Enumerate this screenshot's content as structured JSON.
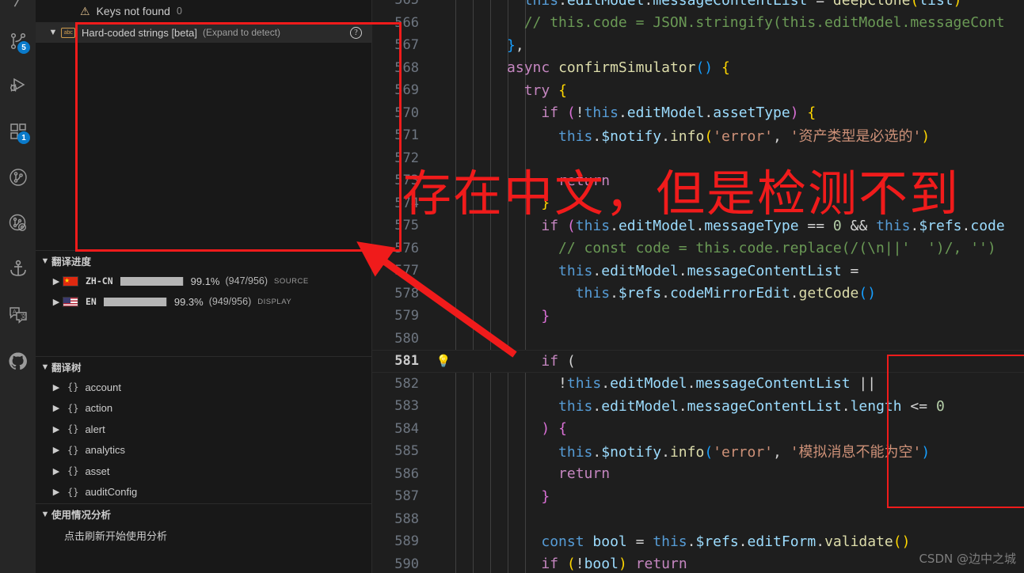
{
  "activity_bar": {
    "items": [
      {
        "name": "source-control-icon",
        "badge": "5"
      },
      {
        "name": "run-and-debug-icon",
        "badge": ""
      },
      {
        "name": "extensions-icon",
        "badge": "1"
      },
      {
        "name": "git-graph-icon",
        "badge": ""
      },
      {
        "name": "gitlens-icon",
        "badge": ""
      },
      {
        "name": "anchor-icon",
        "badge": ""
      },
      {
        "name": "i18n-ally-icon",
        "badge": ""
      },
      {
        "name": "github-icon",
        "badge": ""
      }
    ]
  },
  "sidebar": {
    "keys_not_found": {
      "label": "Keys not found",
      "count": "0"
    },
    "hardcoded": {
      "title": "Hard-coded strings [beta]",
      "hint": "(Expand to detect)",
      "help": "?",
      "icon": "abc"
    },
    "progress_section": {
      "title": "翻译进度",
      "rows": [
        {
          "lang": "ZH-CN",
          "flag": "cn",
          "percent": "99.1%",
          "fraction": "(947/956)",
          "tag": "SOURCE",
          "bar_pct": 99.1
        },
        {
          "lang": "EN",
          "flag": "us",
          "percent": "99.3%",
          "fraction": "(949/956)",
          "tag": "DISPLAY",
          "bar_pct": 99.3
        }
      ]
    },
    "tree_section": {
      "title": "翻译树",
      "items": [
        {
          "label": "account"
        },
        {
          "label": "action"
        },
        {
          "label": "alert"
        },
        {
          "label": "analytics"
        },
        {
          "label": "asset"
        },
        {
          "label": "auditConfig"
        }
      ]
    },
    "usage_section": {
      "title": "使用情况分析",
      "hint": "点击刷新开始使用分析"
    }
  },
  "editor": {
    "lines": [
      {
        "num": "565",
        "bulb": false,
        "tokens": [
          {
            "t": "        ",
            "c": "t-plain"
          },
          {
            "t": "this",
            "c": "t-kw2"
          },
          {
            "t": ".",
            "c": "t-plain"
          },
          {
            "t": "editModel",
            "c": "t-var"
          },
          {
            "t": ".",
            "c": "t-plain"
          },
          {
            "t": "messageContentList",
            "c": "t-var"
          },
          {
            "t": " = ",
            "c": "t-plain"
          },
          {
            "t": "deepClone",
            "c": "t-fn"
          },
          {
            "t": "(",
            "c": "t-pun"
          },
          {
            "t": "list",
            "c": "t-var"
          },
          {
            "t": ")",
            "c": "t-pun"
          }
        ]
      },
      {
        "num": "566",
        "bulb": false,
        "tokens": [
          {
            "t": "        // this.code = JSON.stringify(this.editModel.messageCont",
            "c": "t-com"
          }
        ]
      },
      {
        "num": "567",
        "bulb": false,
        "tokens": [
          {
            "t": "      ",
            "c": "t-plain"
          },
          {
            "t": "}",
            "c": "t-pun3"
          },
          {
            "t": ",",
            "c": "t-plain"
          }
        ]
      },
      {
        "num": "568",
        "bulb": false,
        "tokens": [
          {
            "t": "      ",
            "c": "t-plain"
          },
          {
            "t": "async ",
            "c": "t-kw"
          },
          {
            "t": "confirmSimulator",
            "c": "t-fn"
          },
          {
            "t": "(",
            "c": "t-pun3"
          },
          {
            "t": ")",
            "c": "t-pun3"
          },
          {
            "t": " ",
            "c": "t-plain"
          },
          {
            "t": "{",
            "c": "t-pun"
          }
        ]
      },
      {
        "num": "569",
        "bulb": false,
        "tokens": [
          {
            "t": "        ",
            "c": "t-plain"
          },
          {
            "t": "try",
            "c": "t-kw"
          },
          {
            "t": " ",
            "c": "t-plain"
          },
          {
            "t": "{",
            "c": "t-pun"
          }
        ]
      },
      {
        "num": "570",
        "bulb": false,
        "tokens": [
          {
            "t": "          ",
            "c": "t-plain"
          },
          {
            "t": "if",
            "c": "t-kw"
          },
          {
            "t": " ",
            "c": "t-plain"
          },
          {
            "t": "(",
            "c": "t-pun2"
          },
          {
            "t": "!",
            "c": "t-plain"
          },
          {
            "t": "this",
            "c": "t-kw2"
          },
          {
            "t": ".",
            "c": "t-plain"
          },
          {
            "t": "editModel",
            "c": "t-var"
          },
          {
            "t": ".",
            "c": "t-plain"
          },
          {
            "t": "assetType",
            "c": "t-var"
          },
          {
            "t": ")",
            "c": "t-pun2"
          },
          {
            "t": " ",
            "c": "t-plain"
          },
          {
            "t": "{",
            "c": "t-pun"
          }
        ]
      },
      {
        "num": "571",
        "bulb": false,
        "tokens": [
          {
            "t": "            ",
            "c": "t-plain"
          },
          {
            "t": "this",
            "c": "t-kw2"
          },
          {
            "t": ".",
            "c": "t-plain"
          },
          {
            "t": "$notify",
            "c": "t-var"
          },
          {
            "t": ".",
            "c": "t-plain"
          },
          {
            "t": "info",
            "c": "t-fn"
          },
          {
            "t": "(",
            "c": "t-pun"
          },
          {
            "t": "'error'",
            "c": "t-str"
          },
          {
            "t": ", ",
            "c": "t-plain"
          },
          {
            "t": "'资产类型是必选的'",
            "c": "t-str"
          },
          {
            "t": ")",
            "c": "t-pun"
          }
        ]
      },
      {
        "num": "572",
        "bulb": false,
        "tokens": []
      },
      {
        "num": "573",
        "bulb": false,
        "tokens": [
          {
            "t": "            ",
            "c": "t-plain"
          },
          {
            "t": "return",
            "c": "t-kw"
          }
        ]
      },
      {
        "num": "574",
        "bulb": false,
        "tokens": [
          {
            "t": "          ",
            "c": "t-plain"
          },
          {
            "t": "}",
            "c": "t-pun"
          }
        ]
      },
      {
        "num": "575",
        "bulb": false,
        "tokens": [
          {
            "t": "          ",
            "c": "t-plain"
          },
          {
            "t": "if",
            "c": "t-kw"
          },
          {
            "t": " ",
            "c": "t-plain"
          },
          {
            "t": "(",
            "c": "t-pun2"
          },
          {
            "t": "this",
            "c": "t-kw2"
          },
          {
            "t": ".",
            "c": "t-plain"
          },
          {
            "t": "editModel",
            "c": "t-var"
          },
          {
            "t": ".",
            "c": "t-plain"
          },
          {
            "t": "messageType",
            "c": "t-var"
          },
          {
            "t": " == ",
            "c": "t-plain"
          },
          {
            "t": "0",
            "c": "t-num"
          },
          {
            "t": " && ",
            "c": "t-plain"
          },
          {
            "t": "this",
            "c": "t-kw2"
          },
          {
            "t": ".",
            "c": "t-plain"
          },
          {
            "t": "$refs",
            "c": "t-var"
          },
          {
            "t": ".",
            "c": "t-plain"
          },
          {
            "t": "code",
            "c": "t-var"
          }
        ]
      },
      {
        "num": "576",
        "bulb": false,
        "tokens": [
          {
            "t": "            // const code = this.code.replace(/(\\n||'  ')/, '')",
            "c": "t-com"
          }
        ]
      },
      {
        "num": "577",
        "bulb": false,
        "tokens": [
          {
            "t": "            ",
            "c": "t-plain"
          },
          {
            "t": "this",
            "c": "t-kw2"
          },
          {
            "t": ".",
            "c": "t-plain"
          },
          {
            "t": "editModel",
            "c": "t-var"
          },
          {
            "t": ".",
            "c": "t-plain"
          },
          {
            "t": "messageContentList",
            "c": "t-var"
          },
          {
            "t": " =",
            "c": "t-plain"
          }
        ]
      },
      {
        "num": "578",
        "bulb": false,
        "tokens": [
          {
            "t": "              ",
            "c": "t-plain"
          },
          {
            "t": "this",
            "c": "t-kw2"
          },
          {
            "t": ".",
            "c": "t-plain"
          },
          {
            "t": "$refs",
            "c": "t-var"
          },
          {
            "t": ".",
            "c": "t-plain"
          },
          {
            "t": "codeMirrorEdit",
            "c": "t-var"
          },
          {
            "t": ".",
            "c": "t-plain"
          },
          {
            "t": "getCode",
            "c": "t-fn"
          },
          {
            "t": "(",
            "c": "t-pun3"
          },
          {
            "t": ")",
            "c": "t-pun3"
          }
        ]
      },
      {
        "num": "579",
        "bulb": false,
        "tokens": [
          {
            "t": "          ",
            "c": "t-plain"
          },
          {
            "t": "}",
            "c": "t-pun2"
          }
        ]
      },
      {
        "num": "580",
        "bulb": false,
        "tokens": []
      },
      {
        "num": "581",
        "bulb": true,
        "current": true,
        "tokens": [
          {
            "t": "          ",
            "c": "t-plain"
          },
          {
            "t": "if",
            "c": "t-kw"
          },
          {
            "t": " ",
            "c": "t-plain"
          },
          {
            "t": "(",
            "c": "t-plain"
          }
        ]
      },
      {
        "num": "582",
        "bulb": false,
        "tokens": [
          {
            "t": "            ",
            "c": "t-plain"
          },
          {
            "t": "!",
            "c": "t-plain"
          },
          {
            "t": "this",
            "c": "t-kw2"
          },
          {
            "t": ".",
            "c": "t-plain"
          },
          {
            "t": "editModel",
            "c": "t-var"
          },
          {
            "t": ".",
            "c": "t-plain"
          },
          {
            "t": "messageContentList",
            "c": "t-var"
          },
          {
            "t": " ||",
            "c": "t-plain"
          }
        ]
      },
      {
        "num": "583",
        "bulb": false,
        "tokens": [
          {
            "t": "            ",
            "c": "t-plain"
          },
          {
            "t": "this",
            "c": "t-kw2"
          },
          {
            "t": ".",
            "c": "t-plain"
          },
          {
            "t": "editModel",
            "c": "t-var"
          },
          {
            "t": ".",
            "c": "t-plain"
          },
          {
            "t": "messageContentList",
            "c": "t-var"
          },
          {
            "t": ".",
            "c": "t-plain"
          },
          {
            "t": "length",
            "c": "t-var"
          },
          {
            "t": " <= ",
            "c": "t-plain"
          },
          {
            "t": "0",
            "c": "t-num"
          }
        ]
      },
      {
        "num": "584",
        "bulb": false,
        "tokens": [
          {
            "t": "          ",
            "c": "t-plain"
          },
          {
            "t": ")",
            "c": "t-pun2"
          },
          {
            "t": " ",
            "c": "t-plain"
          },
          {
            "t": "{",
            "c": "t-pun2"
          }
        ]
      },
      {
        "num": "585",
        "bulb": false,
        "tokens": [
          {
            "t": "            ",
            "c": "t-plain"
          },
          {
            "t": "this",
            "c": "t-kw2"
          },
          {
            "t": ".",
            "c": "t-plain"
          },
          {
            "t": "$notify",
            "c": "t-var"
          },
          {
            "t": ".",
            "c": "t-plain"
          },
          {
            "t": "info",
            "c": "t-fn"
          },
          {
            "t": "(",
            "c": "t-pun3"
          },
          {
            "t": "'error'",
            "c": "t-str"
          },
          {
            "t": ", ",
            "c": "t-plain"
          },
          {
            "t": "'模拟消息不能为空'",
            "c": "t-str"
          },
          {
            "t": ")",
            "c": "t-pun3"
          }
        ]
      },
      {
        "num": "586",
        "bulb": false,
        "tokens": [
          {
            "t": "            ",
            "c": "t-plain"
          },
          {
            "t": "return",
            "c": "t-kw"
          }
        ]
      },
      {
        "num": "587",
        "bulb": false,
        "tokens": [
          {
            "t": "          ",
            "c": "t-plain"
          },
          {
            "t": "}",
            "c": "t-pun2"
          }
        ]
      },
      {
        "num": "588",
        "bulb": false,
        "tokens": []
      },
      {
        "num": "589",
        "bulb": false,
        "tokens": [
          {
            "t": "          ",
            "c": "t-plain"
          },
          {
            "t": "const ",
            "c": "t-kw2"
          },
          {
            "t": "bool",
            "c": "t-var"
          },
          {
            "t": " = ",
            "c": "t-plain"
          },
          {
            "t": "this",
            "c": "t-kw2"
          },
          {
            "t": ".",
            "c": "t-plain"
          },
          {
            "t": "$refs",
            "c": "t-var"
          },
          {
            "t": ".",
            "c": "t-plain"
          },
          {
            "t": "editForm",
            "c": "t-var"
          },
          {
            "t": ".",
            "c": "t-plain"
          },
          {
            "t": "validate",
            "c": "t-fn"
          },
          {
            "t": "(",
            "c": "t-pun"
          },
          {
            "t": ")",
            "c": "t-pun"
          }
        ]
      },
      {
        "num": "590",
        "bulb": false,
        "tokens": [
          {
            "t": "          ",
            "c": "t-plain"
          },
          {
            "t": "if",
            "c": "t-kw"
          },
          {
            "t": " ",
            "c": "t-plain"
          },
          {
            "t": "(",
            "c": "t-pun"
          },
          {
            "t": "!",
            "c": "t-plain"
          },
          {
            "t": "bool",
            "c": "t-var"
          },
          {
            "t": ")",
            "c": "t-pun"
          },
          {
            "t": " ",
            "c": "t-plain"
          },
          {
            "t": "return",
            "c": "t-kw"
          }
        ]
      }
    ]
  },
  "annotations": {
    "callout_text": "存在中文，但是检测不到",
    "callout_color": "#f01b1b"
  },
  "watermark": "CSDN @边中之城"
}
